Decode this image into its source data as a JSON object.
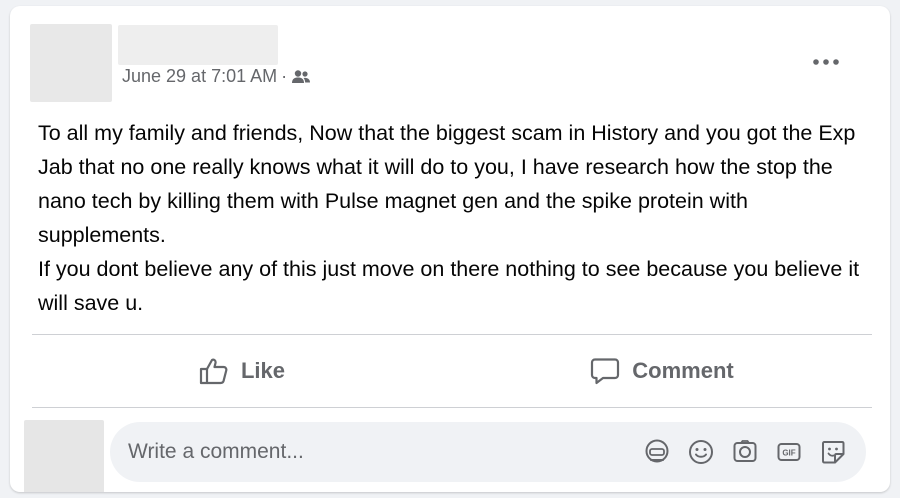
{
  "post": {
    "timestamp": "June 29 at 7:01 AM",
    "separator": "·",
    "audience_icon": "friends-icon",
    "more_icon": "more-options-icon",
    "body": [
      "To all my family and friends, Now that the biggest scam in History and you got the Exp Jab that no one really knows what it will do to you, I have research how the stop the nano tech by killing them with Pulse magnet gen and the spike protein with supplements.",
      "If you dont believe any of this just move on there nothing to see because you believe it will save u."
    ]
  },
  "actions": {
    "like_label": "Like",
    "comment_label": "Comment"
  },
  "comment_composer": {
    "placeholder": "Write a comment...",
    "tools": [
      "avatar-sticker-icon",
      "emoji-icon",
      "camera-icon",
      "gif-icon",
      "sticker-icon"
    ]
  },
  "colors": {
    "secondary_text": "#65676b",
    "primary_text": "#050505",
    "background": "#f0f2f5",
    "card": "#ffffff"
  }
}
